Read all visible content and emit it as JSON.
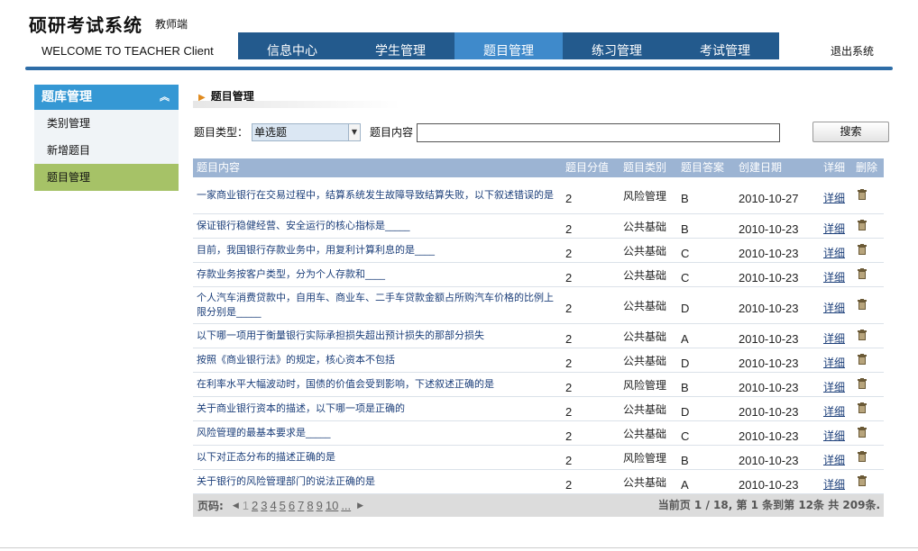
{
  "header": {
    "title": "硕研考试系统",
    "role": "教师端",
    "welcome": "WELCOME TO TEACHER Client",
    "logout": "退出系统"
  },
  "nav": [
    "信息中心",
    "学生管理",
    "题目管理",
    "练习管理",
    "考试管理"
  ],
  "sidebar": {
    "title": "题库管理",
    "items": [
      "类别管理",
      "新增题目",
      "题目管理"
    ]
  },
  "main": {
    "title": "题目管理",
    "filter": {
      "type_label": "题目类型：",
      "type_value": "单选题",
      "content_label": "题目内容",
      "content_value": "",
      "search_button": "搜索"
    }
  },
  "table": {
    "headers": [
      "题目内容",
      "题目分值",
      "题目类别",
      "题目答案",
      "创建日期",
      "详细",
      "删除"
    ],
    "rows": [
      {
        "content": "一家商业银行在交易过程中，结算系统发生故障导致结算失败，以下叙述错误的是",
        "score": "2",
        "category": "风险管理",
        "answer": "B",
        "date": "2010-10-27",
        "detail": "详细"
      },
      {
        "content": "保证银行稳健经营、安全运行的核心指标是_____",
        "score": "2",
        "category": "公共基础",
        "answer": "B",
        "date": "2010-10-23",
        "detail": "详细"
      },
      {
        "content": "目前，我国银行存款业务中，用复利计算利息的是____",
        "score": "2",
        "category": "公共基础",
        "answer": "C",
        "date": "2010-10-23",
        "detail": "详细"
      },
      {
        "content": "存款业务按客户类型，分为个人存款和____",
        "score": "2",
        "category": "公共基础",
        "answer": "C",
        "date": "2010-10-23",
        "detail": "详细"
      },
      {
        "content": "个人汽车消费贷款中，自用车、商业车、二手车贷款金额占所购汽车价格的比例上限分别是_____",
        "score": "2",
        "category": "公共基础",
        "answer": "D",
        "date": "2010-10-23",
        "detail": "详细"
      },
      {
        "content": "以下哪一项用于衡量银行实际承担损失超出预计损失的那部分损失",
        "score": "2",
        "category": "公共基础",
        "answer": "A",
        "date": "2010-10-23",
        "detail": "详细"
      },
      {
        "content": "按照《商业银行法》的规定，核心资本不包括",
        "score": "2",
        "category": "公共基础",
        "answer": "D",
        "date": "2010-10-23",
        "detail": "详细"
      },
      {
        "content": "在利率水平大幅波动时，国债的价值会受到影响，下述叙述正确的是",
        "score": "2",
        "category": "风险管理",
        "answer": "B",
        "date": "2010-10-23",
        "detail": "详细"
      },
      {
        "content": "关于商业银行资本的描述，以下哪一项是正确的",
        "score": "2",
        "category": "公共基础",
        "answer": "D",
        "date": "2010-10-23",
        "detail": "详细"
      },
      {
        "content": "风险管理的最基本要求是_____",
        "score": "2",
        "category": "公共基础",
        "answer": "C",
        "date": "2010-10-23",
        "detail": "详细"
      },
      {
        "content": "以下对正态分布的描述正确的是",
        "score": "2",
        "category": "风险管理",
        "answer": "B",
        "date": "2010-10-23",
        "detail": "详细"
      },
      {
        "content": "关于银行的风险管理部门的说法正确的是",
        "score": "2",
        "category": "公共基础",
        "answer": "A",
        "date": "2010-10-23",
        "detail": "详细"
      }
    ]
  },
  "pager": {
    "label": "页码:",
    "current": "1",
    "pages": [
      "2",
      "3",
      "4",
      "5",
      "6",
      "7",
      "8",
      "9",
      "10",
      "..."
    ],
    "info": "当前页  1 / 18, 第  1 条到第  12条  共  209条."
  }
}
